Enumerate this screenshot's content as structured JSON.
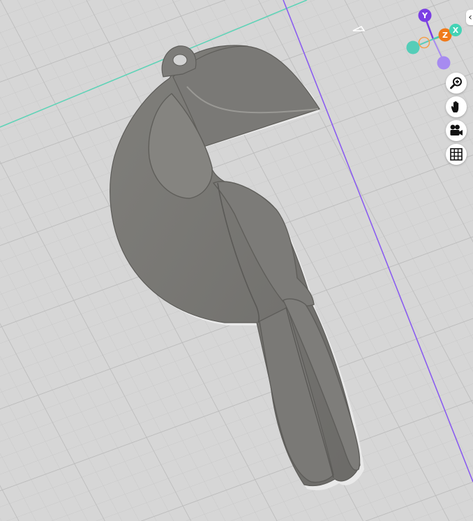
{
  "viewport": {
    "background": "#d6d6d6",
    "grid_color": "#bdbdbd",
    "x_axis_line_color": "#5fd3b7",
    "y_axis_line_color": "#8a5cf0",
    "model_color": "#767572"
  },
  "view_cube": {
    "axes": [
      {
        "name": "y",
        "label": "Y",
        "color": "#7b3fe4"
      },
      {
        "name": "z",
        "label": "Z",
        "color": "#f07a1a"
      },
      {
        "name": "x",
        "label": "X",
        "color": "#43d3b5"
      }
    ],
    "handles": [
      {
        "name": "teal-handle",
        "color": "#55cdb8"
      },
      {
        "name": "orange-ring-handle",
        "color": "#f3a24f"
      },
      {
        "name": "purple-handle",
        "color": "#a78bf0"
      }
    ]
  },
  "toolbar": {
    "items": [
      {
        "name": "zoom-button",
        "icon": "zoom-in-icon"
      },
      {
        "name": "pan-button",
        "icon": "hand-icon"
      },
      {
        "name": "camera-button",
        "icon": "video-camera-icon"
      },
      {
        "name": "grid-toggle-button",
        "icon": "grid-icon"
      }
    ],
    "collapse_icon": "chevron-left-icon",
    "collapse_glyph": "‹"
  }
}
